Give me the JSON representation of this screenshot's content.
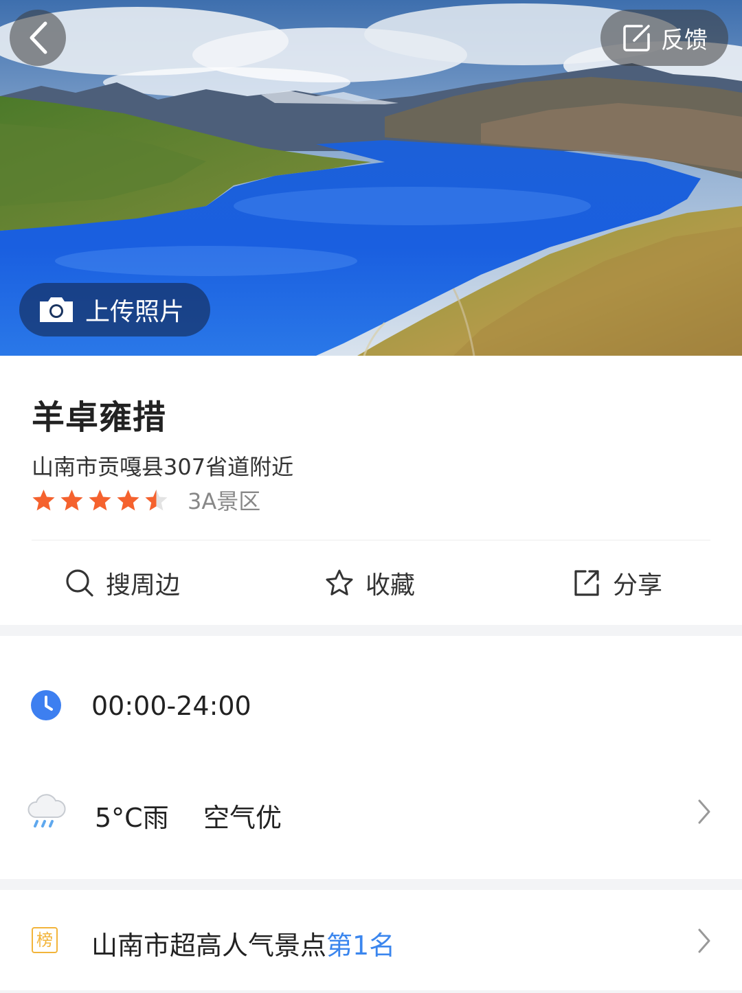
{
  "header": {
    "feedback_label": "反馈",
    "upload_label": "上传照片"
  },
  "poi": {
    "name": "羊卓雍措",
    "address": "山南市贡嘎县307省道附近",
    "rating_stars": 4.5,
    "rating_max": 5,
    "level": "3A景区",
    "star_color": "#f5622e"
  },
  "actions": [
    {
      "label": "搜周边",
      "icon": "search-icon"
    },
    {
      "label": "收藏",
      "icon": "star-outline-icon"
    },
    {
      "label": "分享",
      "icon": "share-icon"
    }
  ],
  "hours": {
    "icon": "clock-icon",
    "text": "00:00-24:00"
  },
  "weather": {
    "icon": "rain-cloud-icon",
    "temp": "5°C雨",
    "air": "空气优"
  },
  "ranking": {
    "badge": "榜",
    "text": "山南市超高人气景点",
    "highlight": "第1名",
    "highlight_color": "#3b86ee"
  }
}
